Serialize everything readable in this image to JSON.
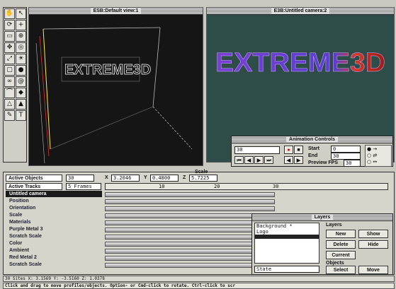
{
  "toolbox": {
    "tools": [
      "hand-icon",
      "pointer-icon",
      "rotate-icon",
      "plus-icon",
      "select-icon",
      "zoom-icon",
      "move-icon",
      "camera-icon",
      "scale-icon",
      "light-icon",
      "box-icon",
      "sphere-icon",
      "link-icon",
      "spiral-icon",
      "path-icon",
      "node-icon",
      "triangle-icon",
      "cone-icon",
      "pen-icon",
      "text-icon"
    ]
  },
  "view1": {
    "title": "ESB:Default view:1",
    "logo_text": "EXTREME3D"
  },
  "view2": {
    "title": "E3B:Untitled camera:2",
    "logo_text": "EXTREME3D"
  },
  "header": {
    "active_objects_label": "Active Objects",
    "active_objects_value": "30",
    "active_tracks_label": "Active Tracks",
    "active_tracks_value": "5 Frames",
    "scale_label": "Scale",
    "x_label": "X",
    "x_value": "3.2046",
    "y_label": "Y",
    "y_value": "0.4800",
    "z_label": "Z",
    "z_value": "5.7225"
  },
  "ruler": {
    "ticks": [
      "10",
      "20",
      "30"
    ]
  },
  "tracks": [
    {
      "label": "Untitled camera",
      "selected": true
    },
    {
      "label": "Position",
      "selected": false
    },
    {
      "label": "Orientation",
      "selected": false
    },
    {
      "label": "Scale",
      "selected": false
    },
    {
      "label": "Materials",
      "selected": false
    },
    {
      "label": "Purple Metal 3",
      "selected": false
    },
    {
      "label": "Scratch Scale",
      "selected": false
    },
    {
      "label": "Color",
      "selected": false
    },
    {
      "label": "Ambient",
      "selected": false
    },
    {
      "label": "Red Metal 2",
      "selected": false
    },
    {
      "label": "Scratch Scale",
      "selected": false
    }
  ],
  "anim": {
    "title": "Animation Controls",
    "frame_value": "30",
    "start_label": "Start",
    "start_value": "0",
    "end_label": "End",
    "end_value": "30",
    "fps_label": "Preview FPS",
    "fps_value": "30"
  },
  "layers": {
    "title": "Layers",
    "items": [
      "Background *",
      "Logo"
    ],
    "layers_label": "Layers",
    "objects_label": "Objects",
    "new_label": "New",
    "show_label": "Show",
    "delete_label": "Delete",
    "hide_label": "Hide",
    "current_label": "Current",
    "field_value": "State",
    "select_label": "Select",
    "move_label": "Move"
  },
  "status": {
    "text": "30 Sites  X: 3.1569 Y: -3.5160 Z: 1.0378",
    "hint": "Click and drag to move profiles/objects. Option- or Cmd-click to rotate. Ctrl-click to scr"
  }
}
